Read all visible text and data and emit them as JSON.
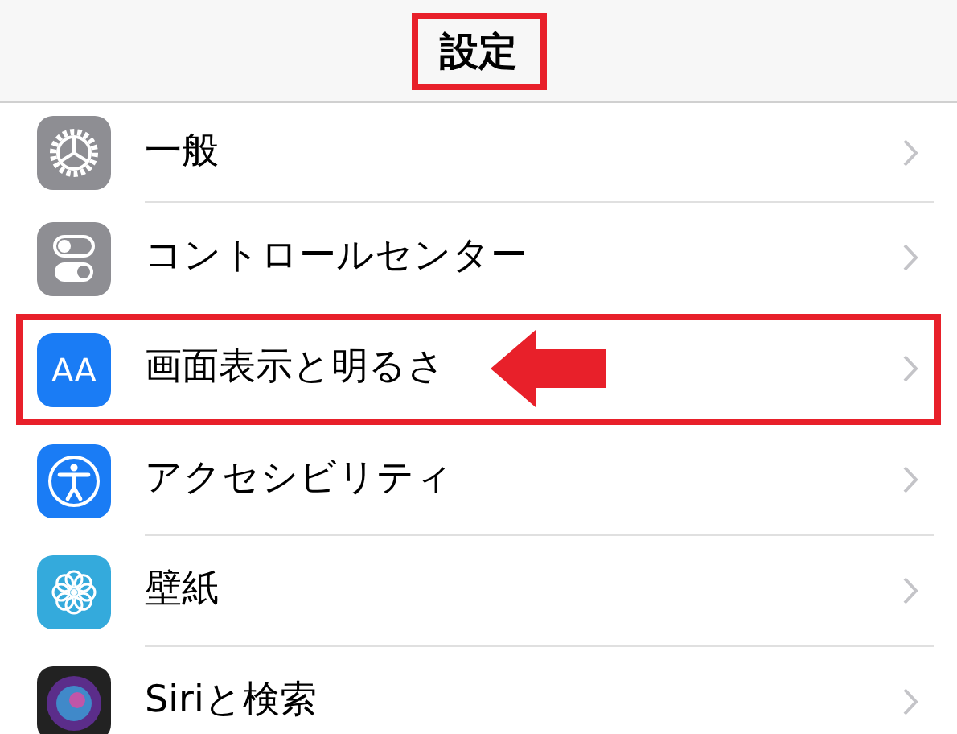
{
  "header": {
    "title": "設定",
    "highlighted": true
  },
  "rows": [
    {
      "kind": "gear",
      "label": "一般",
      "highlighted": false
    },
    {
      "kind": "switches",
      "label": "コントロールセンター",
      "highlighted": false
    },
    {
      "kind": "text-size",
      "icon_text": "AA",
      "label": "画面表示と明るさ",
      "highlighted": true
    },
    {
      "kind": "accessibility",
      "label": "アクセシビリティ",
      "highlighted": false
    },
    {
      "kind": "flower",
      "label": "壁紙",
      "highlighted": false
    },
    {
      "kind": "siri",
      "label": "Siriと検索",
      "highlighted": false
    }
  ]
}
